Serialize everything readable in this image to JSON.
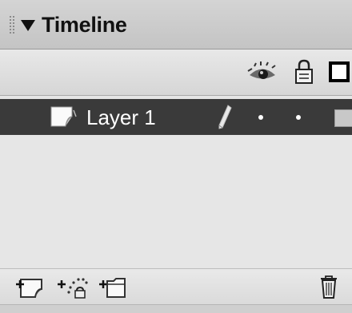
{
  "panel": {
    "title": "Timeline"
  },
  "header": {
    "icons": [
      "eye-icon",
      "lock-icon",
      "outline-icon"
    ]
  },
  "layers": [
    {
      "name": "Layer 1",
      "selected": true,
      "icon": "layer-icon",
      "status_icon": "pencil-icon",
      "outline_color": "#c8c8c8"
    }
  ],
  "toolbar": {
    "buttons": [
      "insert-layer-icon",
      "add-motion-guide-icon",
      "insert-layer-folder-icon",
      "trash-icon"
    ]
  },
  "colors": {
    "selected_row": "#3a3a3a",
    "panel_bg": "#e4e4e4"
  }
}
